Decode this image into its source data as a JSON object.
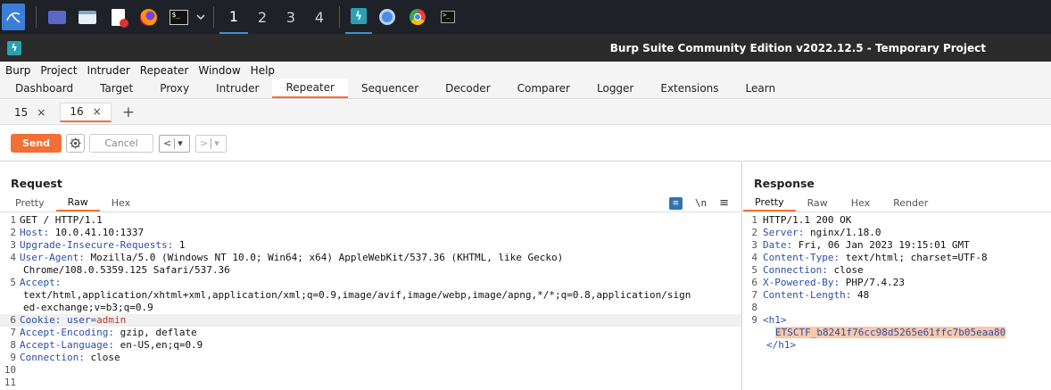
{
  "taskbar": {
    "workspaces": [
      "1",
      "2",
      "3",
      "4"
    ]
  },
  "window": {
    "title": "Burp Suite Community Edition v2022.12.5 - Temporary Project"
  },
  "menu": [
    "Burp",
    "Project",
    "Intruder",
    "Repeater",
    "Window",
    "Help"
  ],
  "main_tabs": [
    "Dashboard",
    "Target",
    "Proxy",
    "Intruder",
    "Repeater",
    "Sequencer",
    "Decoder",
    "Comparer",
    "Logger",
    "Extensions",
    "Learn"
  ],
  "active_main_tab": "Repeater",
  "repeater_tabs": [
    {
      "label": "15",
      "close": "×"
    },
    {
      "label": "16",
      "close": "×"
    }
  ],
  "add_tab": "+",
  "toolbar": {
    "send_label": "Send",
    "cancel_label": "Cancel",
    "prev": "<",
    "next": ">",
    "dropdown": "▾"
  },
  "request": {
    "title": "Request",
    "tabs": [
      "Pretty",
      "Raw",
      "Hex"
    ],
    "active_tab": "Raw",
    "newline_toggle": "\\n",
    "lines": [
      {
        "n": "1",
        "text": "GET / HTTP/1.1"
      },
      {
        "n": "2",
        "key": "Host",
        "value": " 10.0.41.10:1337"
      },
      {
        "n": "3",
        "key": "Upgrade-Insecure-Requests",
        "value": " 1"
      },
      {
        "n": "4",
        "key": "User-Agent",
        "value": " Mozilla/5.0 (Windows NT 10.0; Win64; x64) AppleWebKit/537.36 (KHTML, like Gecko)"
      },
      {
        "n": "",
        "text": "Chrome/108.0.5359.125 Safari/537.36"
      },
      {
        "n": "5",
        "key": "Accept",
        "value": ""
      },
      {
        "n": "",
        "text": "text/html,application/xhtml+xml,application/xml;q=0.9,image/avif,image/webp,image/apng,*/*;q=0.8,application/sign"
      },
      {
        "n": "",
        "text": "ed-exchange;v=b3;q=0.9"
      },
      {
        "n": "6",
        "key": "Cookie",
        "cookie_name": " user=",
        "cookie_value": "admin"
      },
      {
        "n": "7",
        "key": "Accept-Encoding",
        "value": " gzip, deflate"
      },
      {
        "n": "8",
        "key": "Accept-Language",
        "value": " en-US,en;q=0.9"
      },
      {
        "n": "9",
        "key": "Connection",
        "value": " close"
      },
      {
        "n": "10",
        "text": ""
      },
      {
        "n": "11",
        "text": ""
      }
    ]
  },
  "response": {
    "title": "Response",
    "tabs": [
      "Pretty",
      "Raw",
      "Hex",
      "Render"
    ],
    "active_tab": "Pretty",
    "lines": [
      {
        "n": "1",
        "text": "HTTP/1.1 200 OK"
      },
      {
        "n": "2",
        "key": "Server",
        "value": " nginx/1.18.0"
      },
      {
        "n": "3",
        "key": "Date",
        "value": " Fri, 06 Jan 2023 19:15:01 GMT"
      },
      {
        "n": "4",
        "key": "Content-Type",
        "value": " text/html; charset=UTF-8"
      },
      {
        "n": "5",
        "key": "Connection",
        "value": " close"
      },
      {
        "n": "6",
        "key": "X-Powered-By",
        "value": " PHP/7.4.23"
      },
      {
        "n": "7",
        "key": "Content-Length",
        "value": " 48"
      },
      {
        "n": "8",
        "text": ""
      },
      {
        "n": "9",
        "text": "<h1>"
      },
      {
        "n": "",
        "flag": "ETSCTF_b8241f76cc98d5265e61ffc7b05eaa80"
      },
      {
        "n": "",
        "text": "</h1>"
      }
    ]
  },
  "colors": {
    "accent": "#f26f35",
    "key": "#2b4fa8",
    "cookie_value": "#c0392b",
    "flag_highlight": "#fbc8a8"
  }
}
